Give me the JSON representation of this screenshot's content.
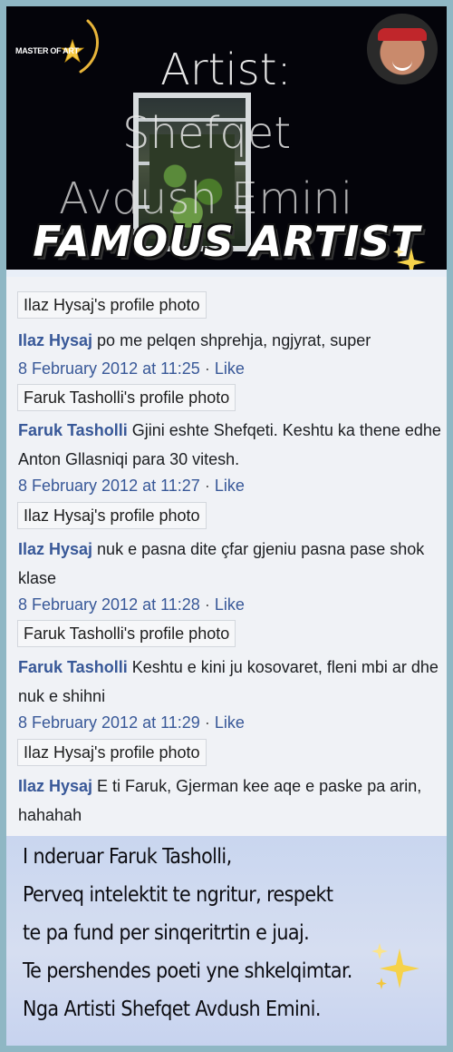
{
  "banner": {
    "badge": "MASTER OF ART",
    "title_lines": [
      "Artist:",
      "Shefqet",
      "Avdush Emini"
    ],
    "headline": "FAMOUS ARTIST",
    "icons": [
      "star-icon",
      "sparkle-icon",
      "avatar"
    ]
  },
  "comments": [
    {
      "photo_label": "Ilaz Hysaj's profile photo",
      "name": "Ilaz Hysaj",
      "text": " po me pelqen shprehja, ngjyrat, super",
      "date": "8 February 2012 at 11:25",
      "like": "Like"
    },
    {
      "photo_label": "Faruk Tasholli's profile photo",
      "name": "Faruk Tasholli",
      "text": " Gjini eshte Shefqeti. Keshtu ka thene edhe Anton Gllasniqi para 30 vitesh.",
      "date": "8 February 2012 at 11:27",
      "like": "Like"
    },
    {
      "photo_label": "Ilaz Hysaj's profile photo",
      "name": "Ilaz Hysaj",
      "text": " nuk e pasna dite çfar gjeniu pasna pase shok klase",
      "date": "8 February 2012 at 11:28",
      "like": "Like"
    },
    {
      "photo_label": "Faruk Tasholli's profile photo",
      "name": "Faruk Tasholli",
      "text": " Keshtu e kini ju kosovaret, fleni mbi ar dhe nuk e shihni",
      "date": "8 February 2012 at 11:29",
      "like": "Like"
    },
    {
      "photo_label": "Ilaz Hysaj's profile photo",
      "name": "Ilaz Hysaj",
      "text": " E ti Faruk, Gjerman kee aqe e paske pa arin, hahahah"
    }
  ],
  "meta_separator": "·",
  "message": {
    "lines": [
      "I nderuar Faruk Tasholli,",
      "Perveq intelektit te ngritur, respekt",
      "te pa fund per sinqeritrtin e juaj.",
      "Te pershendes poeti yne shkelqimtar.",
      "Nga Artisti Shefqet Avdush Emini."
    ]
  },
  "colors": {
    "link": "#385898",
    "frame": "#8fb7c4",
    "banner_bg": "#04040a",
    "message_bg": "#c9d6ef",
    "sparkle": "#f6d24a"
  }
}
